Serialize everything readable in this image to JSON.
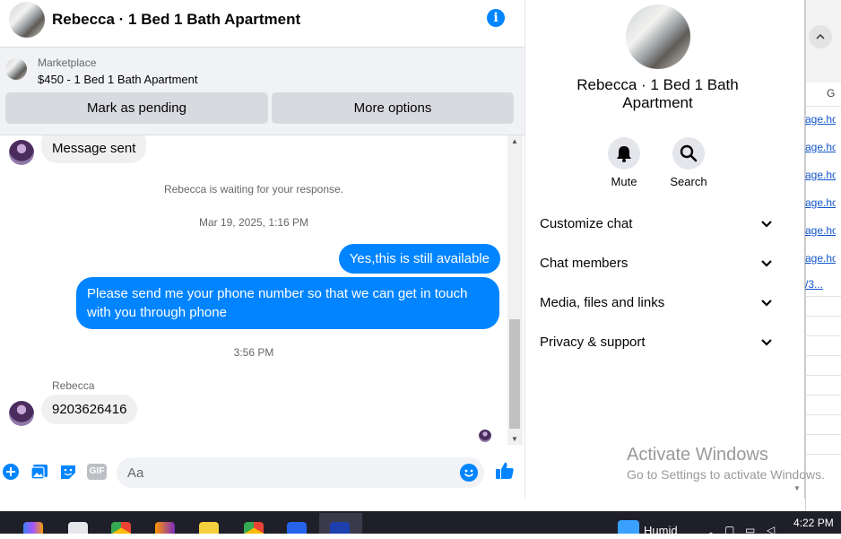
{
  "header": {
    "title": "Rebecca · 1 Bed 1 Bath Apartment",
    "info_glyph": "i"
  },
  "listing": {
    "source": "Marketplace",
    "title": "$450 - 1 Bed 1 Bath Apartment",
    "mark_pending_label": "Mark as pending",
    "more_options_label": "More options"
  },
  "messages": {
    "first_incoming": "Message sent",
    "waiting_notice": "Rebecca is waiting for your response.",
    "timestamp_1": "Mar 19, 2025, 1:16 PM",
    "outgoing_1": "Yes,this is still available",
    "outgoing_2": "Please send me your phone  number so that we can get in touch with you through phone",
    "timestamp_2": "3:56 PM",
    "sender_name": "Rebecca",
    "incoming_phone": "9203626416"
  },
  "composer": {
    "placeholder": "Aa",
    "gif_label": "GIF"
  },
  "panel": {
    "title": "Rebecca · 1 Bed 1 Bath Apartment",
    "actions": [
      {
        "label": "Mute",
        "icon": "bell-icon"
      },
      {
        "label": "Search",
        "icon": "search-icon"
      }
    ],
    "sections": [
      {
        "label": "Customize chat"
      },
      {
        "label": "Chat members"
      },
      {
        "label": "Media, files and links"
      },
      {
        "label": "Privacy & support"
      }
    ]
  },
  "sheet": {
    "column_label": "G",
    "links": [
      "age.ho",
      "age.ho",
      "age.ho",
      "age.ho",
      "age.ho",
      "age.ho",
      "/3..."
    ]
  },
  "watermark": {
    "line1": "Activate Windows",
    "line2": "Go to Settings to activate Windows."
  },
  "taskbar": {
    "weather": "Humid",
    "clock": "4:22 PM"
  },
  "colors": {
    "messenger_blue": "#0084ff",
    "incoming_bubble": "#f0f0f0",
    "button_gray": "#d8dadf"
  }
}
